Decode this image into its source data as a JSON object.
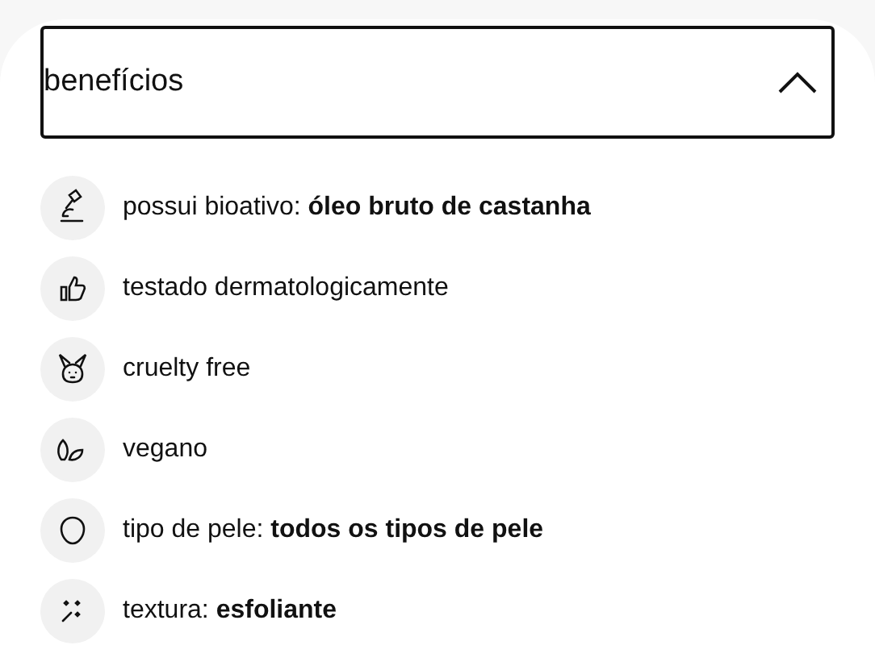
{
  "accordion": {
    "title": "benefícios",
    "expanded": true
  },
  "items": [
    {
      "text": "possui bioativo: **óleo bruto de castanha**"
    },
    {
      "text": "testado dermatologicamente"
    },
    {
      "text": "cruelty free"
    },
    {
      "text": "vegano"
    },
    {
      "text": "tipo de pele: **todos os tipos de pele**"
    },
    {
      "text": "textura: **esfoliante**"
    }
  ]
}
